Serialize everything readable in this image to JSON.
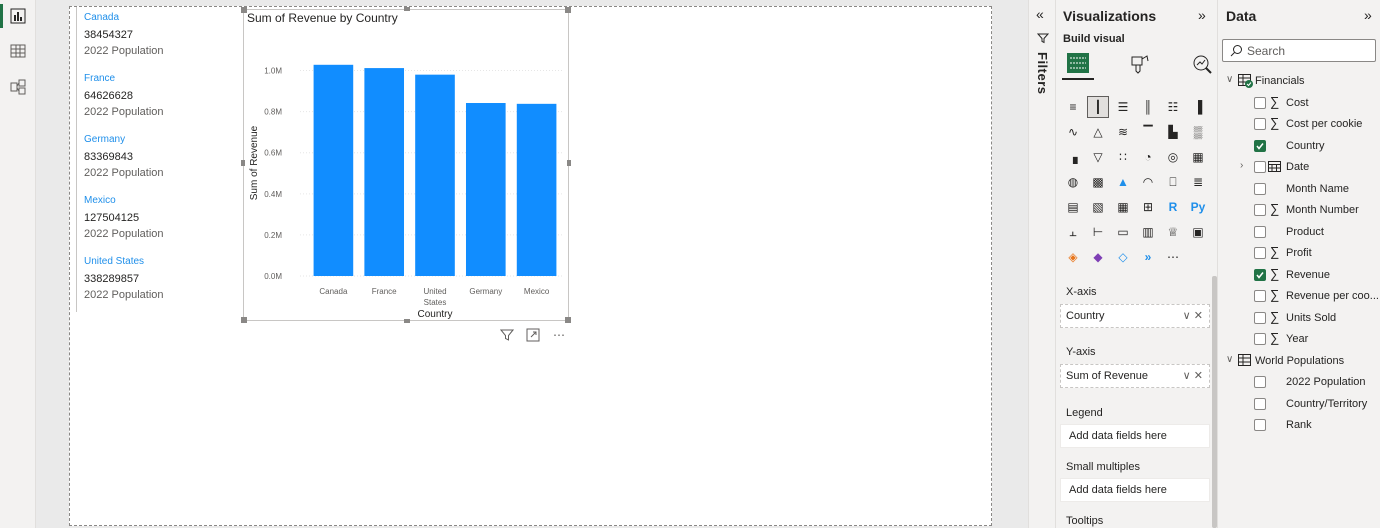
{
  "left_nav": {
    "items": [
      {
        "name": "report-view-icon"
      },
      {
        "name": "table-view-icon"
      },
      {
        "name": "model-view-icon"
      }
    ]
  },
  "cards": [
    {
      "country": "Canada",
      "value": "38454327",
      "label": "2022 Population"
    },
    {
      "country": "France",
      "value": "64626628",
      "label": "2022 Population"
    },
    {
      "country": "Germany",
      "value": "83369843",
      "label": "2022 Population"
    },
    {
      "country": "Mexico",
      "value": "127504125",
      "label": "2022 Population"
    },
    {
      "country": "United States",
      "value": "338289857",
      "label": "2022 Population"
    }
  ],
  "chart_data": {
    "type": "bar",
    "title": "Sum of Revenue by Country",
    "xlabel": "Country",
    "ylabel": "Sum of Revenue",
    "categories": [
      "Canada",
      "France",
      "United States",
      "Germany",
      "Mexico"
    ],
    "category_lines": [
      [
        "Canada"
      ],
      [
        "France"
      ],
      [
        "United",
        "States"
      ],
      [
        "Germany"
      ],
      [
        "Mexico"
      ]
    ],
    "values": [
      1028000,
      1012000,
      980000,
      842000,
      838000
    ],
    "ylim": [
      0,
      1100000
    ],
    "yticks": [
      0,
      200000,
      400000,
      600000,
      800000,
      1000000
    ],
    "ytick_labels": [
      "0.0M",
      "0.2M",
      "0.4M",
      "0.6M",
      "0.8M",
      "1.0M"
    ],
    "bar_color": "#118dff",
    "grid": true
  },
  "filters": {
    "label": "Filters"
  },
  "visualizations": {
    "title": "Visualizations",
    "build_visual": "Build visual",
    "x_axis_label": "X-axis",
    "x_axis_field": "Country",
    "y_axis_label": "Y-axis",
    "y_axis_field": "Sum of Revenue",
    "legend_label": "Legend",
    "legend_placeholder": "Add data fields here",
    "small_multiples_label": "Small multiples",
    "small_multiples_placeholder": "Add data fields here",
    "tooltips_label": "Tooltips",
    "visual_icons": [
      "stacked-bar-icon",
      "stacked-column-icon",
      "clustered-bar-icon",
      "clustered-column-icon",
      "100-stacked-bar-icon",
      "100-stacked-column-icon",
      "line-chart-icon",
      "area-chart-icon",
      "stacked-area-icon",
      "line-stacked-column-icon",
      "line-clustered-column-icon",
      "ribbon-chart-icon",
      "waterfall-icon",
      "funnel-icon",
      "scatter-icon",
      "pie-chart-icon",
      "donut-chart-icon",
      "treemap-icon",
      "map-icon",
      "filled-map-icon",
      "azure-map-icon",
      "gauge-icon",
      "card-icon",
      "multi-row-card-icon",
      "kpi-icon",
      "slicer-icon",
      "table-icon",
      "matrix-icon",
      "r-visual-icon",
      "python-visual-icon",
      "key-influencers-icon",
      "decomposition-tree-icon",
      "qa-icon",
      "smart-narrative-icon",
      "metrics-icon",
      "paginated-report-icon",
      "arcgis-icon",
      "power-apps-icon",
      "power-automate-icon",
      "power-bi-icon",
      "more-visuals-icon"
    ]
  },
  "data_pane": {
    "title": "Data",
    "search_placeholder": "Search",
    "tables": [
      {
        "name": "Financials",
        "fields": [
          {
            "name": "Cost",
            "sigma": true,
            "checked": false
          },
          {
            "name": "Cost per cookie",
            "sigma": true,
            "checked": false
          },
          {
            "name": "Country",
            "sigma": false,
            "checked": true
          },
          {
            "name": "Date",
            "sigma": false,
            "checked": false,
            "calendar": true
          },
          {
            "name": "Month Name",
            "sigma": false,
            "checked": false
          },
          {
            "name": "Month Number",
            "sigma": true,
            "checked": false
          },
          {
            "name": "Product",
            "sigma": false,
            "checked": false
          },
          {
            "name": "Profit",
            "sigma": true,
            "checked": false
          },
          {
            "name": "Revenue",
            "sigma": true,
            "checked": true
          },
          {
            "name": "Revenue per coo...",
            "sigma": true,
            "checked": false
          },
          {
            "name": "Units Sold",
            "sigma": true,
            "checked": false
          },
          {
            "name": "Year",
            "sigma": true,
            "checked": false
          }
        ]
      },
      {
        "name": "World Populations",
        "fields": [
          {
            "name": "2022 Population",
            "sigma": false,
            "checked": false
          },
          {
            "name": "Country/Territory",
            "sigma": false,
            "checked": false
          },
          {
            "name": "Rank",
            "sigma": false,
            "checked": false
          }
        ]
      }
    ]
  },
  "colors": {
    "accent_green": "#217346",
    "bar_blue": "#118dff",
    "card_name_blue": "#1f8fea"
  }
}
